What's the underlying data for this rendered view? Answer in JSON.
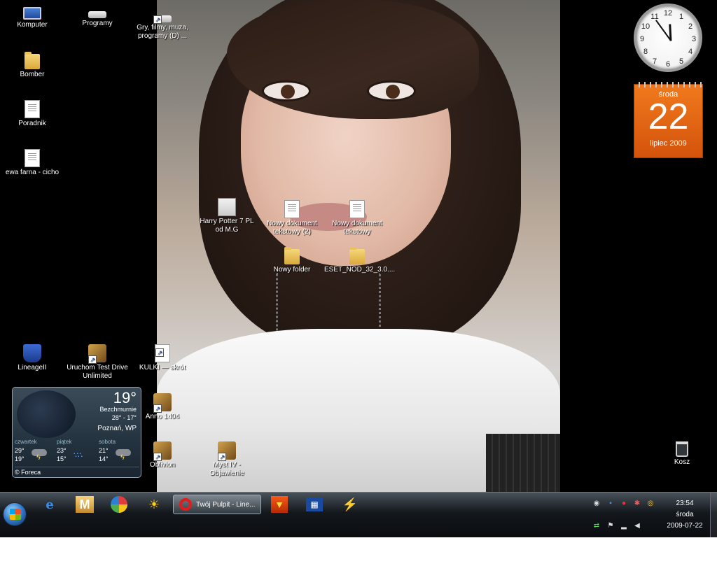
{
  "desktop": {
    "icons": [
      {
        "label": "Komputer"
      },
      {
        "label": "Programy"
      },
      {
        "label": "Gry, filmy, muza, programy (D) ..."
      },
      {
        "label": "Bomber"
      },
      {
        "label": "Poradnik"
      },
      {
        "label": "ewa farna - cicho"
      },
      {
        "label": "Harry Potter 7 PL od M.G"
      },
      {
        "label": "Nowy dokument tekstowy (2)"
      },
      {
        "label": "Nowy dokument tekstowy"
      },
      {
        "label": "Nowy folder"
      },
      {
        "label": "ESET_NOD_32_3.0...."
      },
      {
        "label": "LineageII"
      },
      {
        "label": "Uruchom Test Drive Unlimited"
      },
      {
        "label": "KULKI — skrót"
      },
      {
        "label": "Anno 1404"
      },
      {
        "label": "Oblivion"
      },
      {
        "label": "Myst IV - Objawienie"
      },
      {
        "label": "Kosz"
      }
    ]
  },
  "gadgets": {
    "clock": {
      "numbers": [
        "12",
        "1",
        "2",
        "3",
        "4",
        "5",
        "6",
        "7",
        "8",
        "9",
        "10",
        "11"
      ],
      "time": "23:54"
    },
    "calendar": {
      "weekday": "środa",
      "day": "22",
      "month": "lipiec 2009"
    },
    "weather": {
      "temperature": "19°",
      "condition": "Bezchmurnie",
      "high_low": "28° - 17°",
      "location": "Poznań, WP",
      "forecast": [
        {
          "day": "czwartek",
          "high": "29°",
          "low": "19°",
          "icon": "storm-icon"
        },
        {
          "day": "piątek",
          "high": "23°",
          "low": "15°",
          "icon": "rain-icon"
        },
        {
          "day": "sobota",
          "high": "21°",
          "low": "14°",
          "icon": "storm-icon"
        }
      ],
      "footer": "© Foreca"
    }
  },
  "taskbar": {
    "active_task_label": "Twój Pulpit - Line...",
    "m_label": "M",
    "clock": {
      "time": "23:54",
      "weekday": "środa",
      "date": "2009-07-22"
    }
  },
  "colors": {
    "calendar_orange": "#e2620f",
    "taskbar_dark": "#0a0c10"
  }
}
